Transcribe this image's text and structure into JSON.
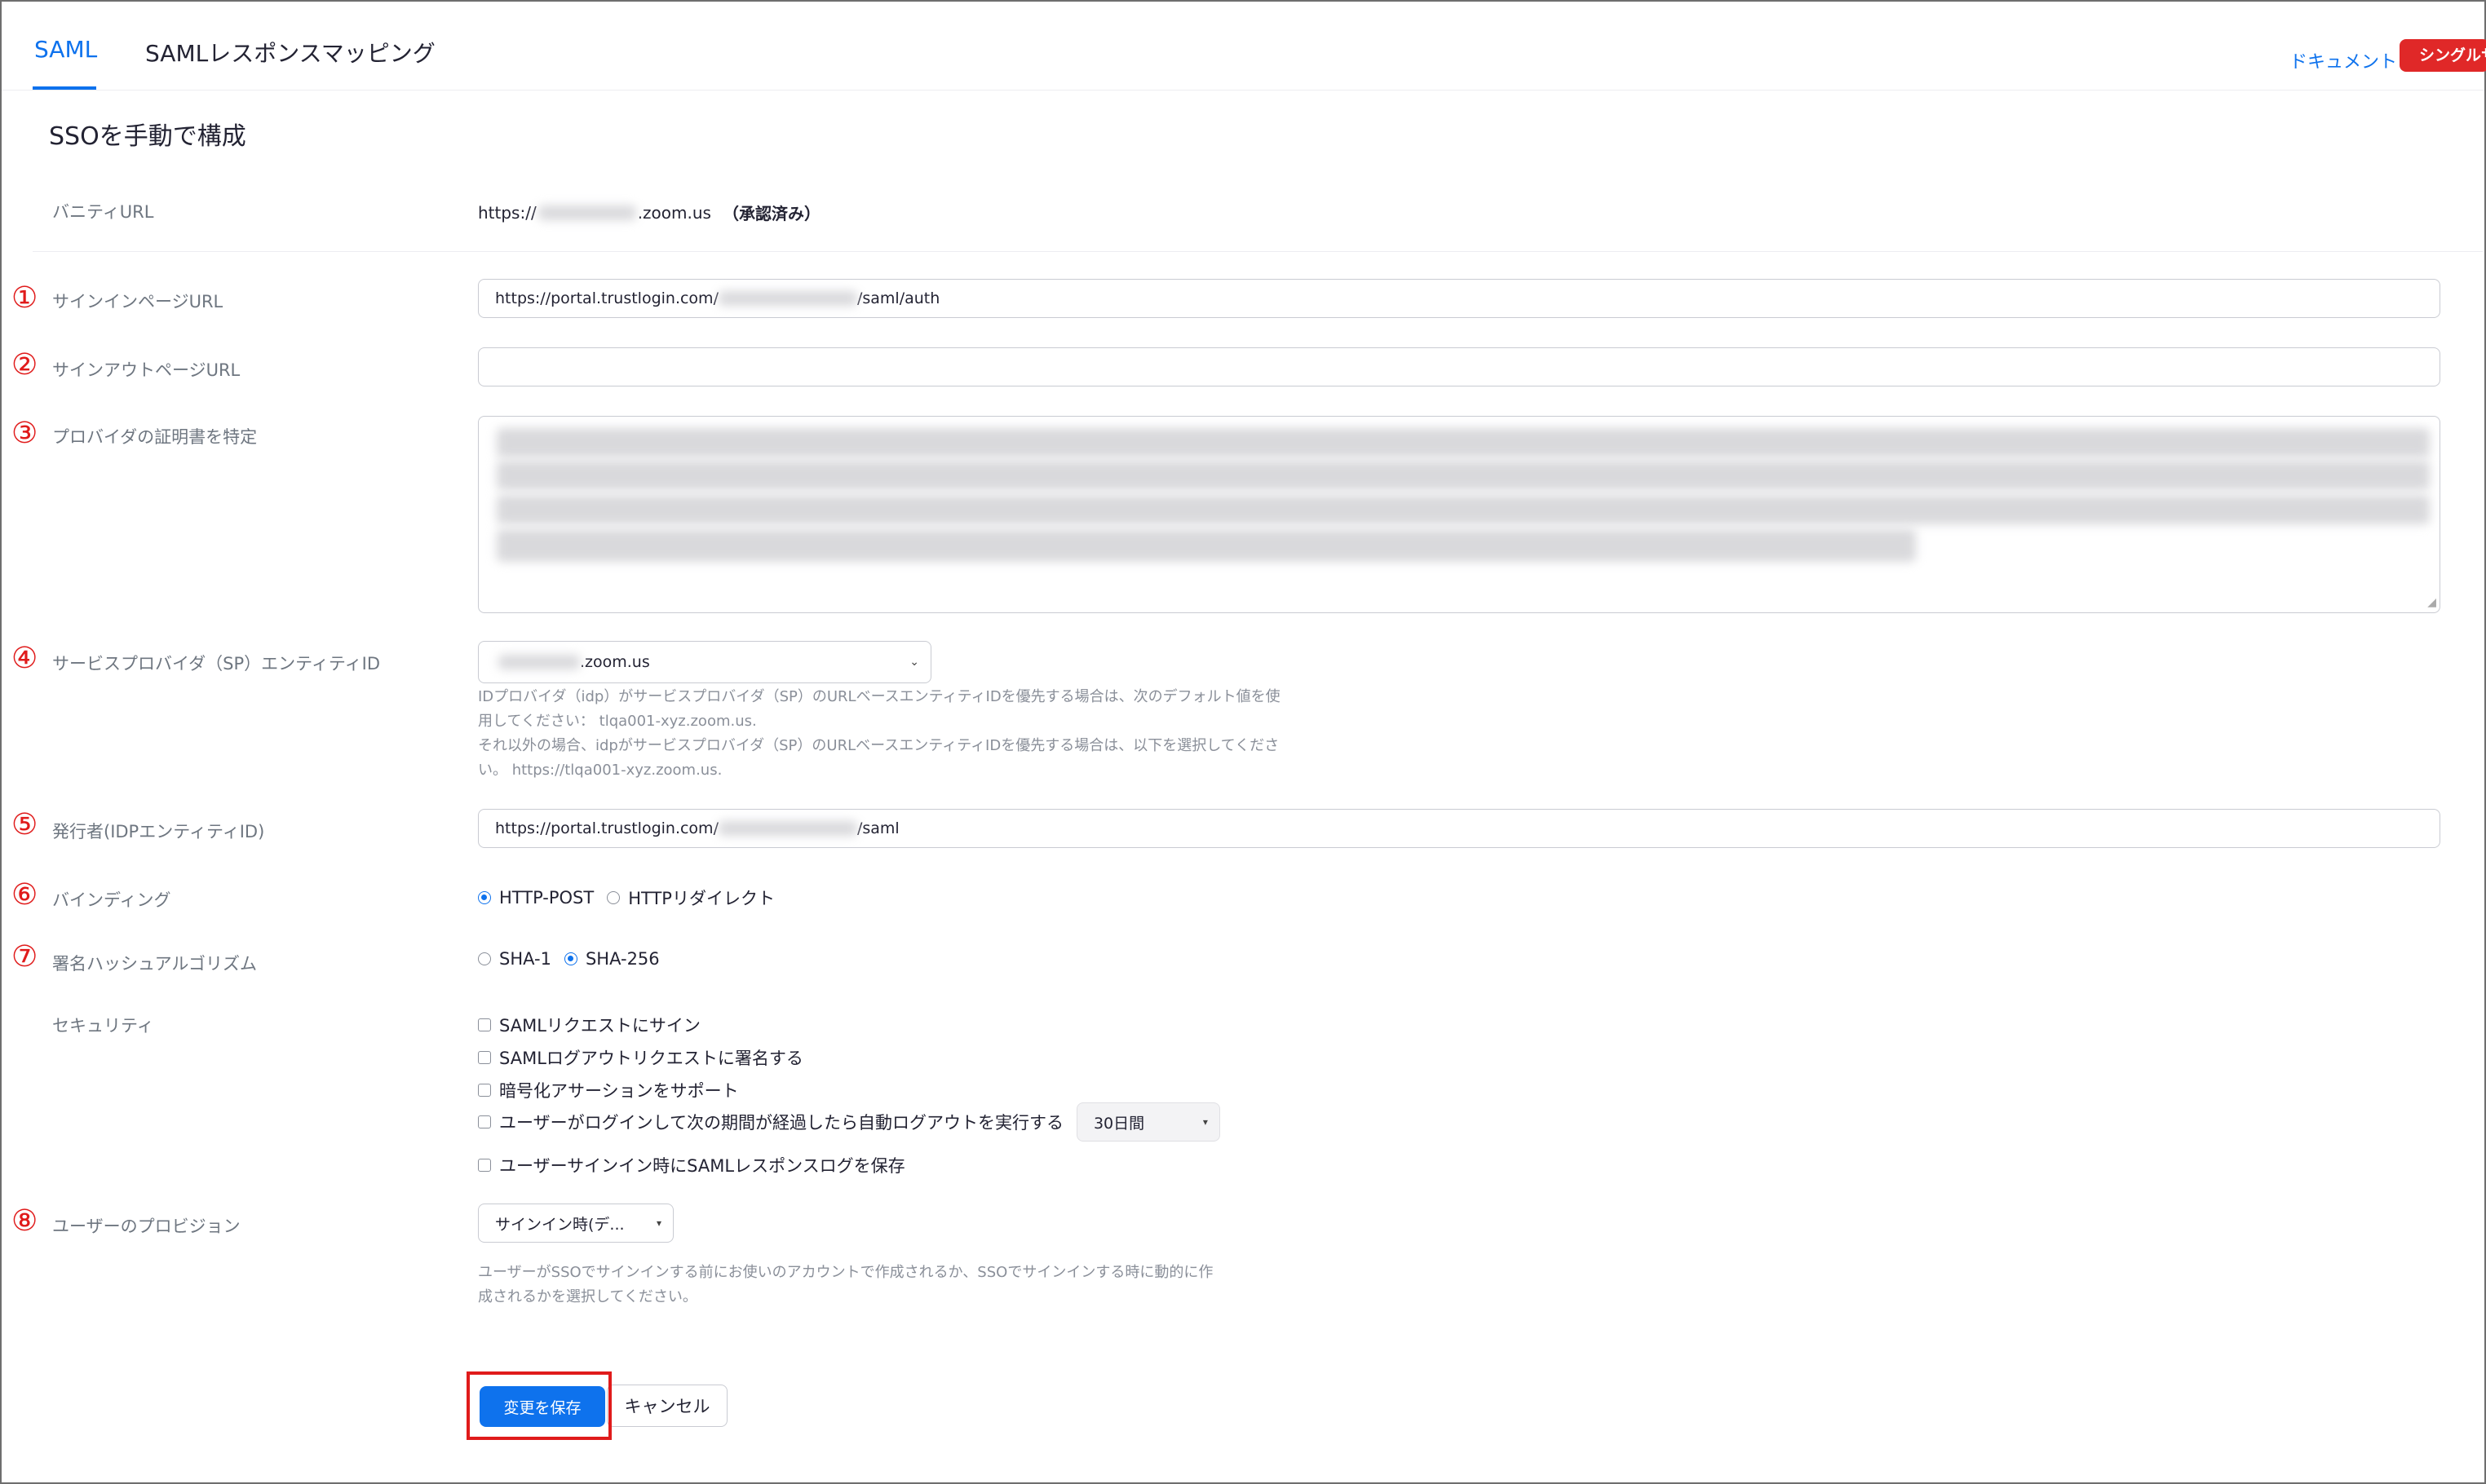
{
  "tabs": [
    {
      "label": "SAML",
      "active": true
    },
    {
      "label": "SAMLレスポンスマッピング",
      "active": false
    }
  ],
  "header_links": {
    "document": "ドキュメント",
    "single_btn": "シングルサ"
  },
  "section_title": "SSOを手動で構成",
  "vanity": {
    "label": "バニティURL",
    "value_prefix": "https://",
    "value_suffix": ".zoom.us",
    "status": "（承認済み）"
  },
  "numbers": [
    "①",
    "②",
    "③",
    "④",
    "⑤",
    "⑥",
    "⑦",
    "⑧"
  ],
  "fields": {
    "signin": {
      "label": "サインインページURL",
      "prefix": "https://portal.trustlogin.com/",
      "suffix": "/saml/auth"
    },
    "signout": {
      "label": "サインアウトページURL",
      "value": ""
    },
    "cert": {
      "label": "プロバイダの証明書を特定"
    },
    "sp_entity": {
      "label": "サービスプロバイダ（SP）エンティティID",
      "selected_suffix": ".zoom.us",
      "help": [
        "IDプロバイダ（idp）がサービスプロバイダ（SP）のURLベースエンティティIDを優先する場合は、次のデフォルト値を使",
        "用してください： tlqa001-xyz.zoom.us.",
        "それ以外の場合、idpがサービスプロバイダ（SP）のURLベースエンティティIDを優先する場合は、以下を選択してくださ",
        "い。 https://tlqa001-xyz.zoom.us."
      ]
    },
    "issuer": {
      "label": "発行者(IDPエンティティID)",
      "prefix": "https://portal.trustlogin.com/",
      "suffix": "/saml"
    },
    "binding": {
      "label": "バインディング",
      "options": [
        "HTTP-POST",
        "HTTPリダイレクト"
      ],
      "selected": 0
    },
    "hash": {
      "label": "署名ハッシュアルゴリズム",
      "options": [
        "SHA-1",
        "SHA-256"
      ],
      "selected": 1
    },
    "security": {
      "label": "セキュリティ",
      "options": [
        "SAMLリクエストにサイン",
        "SAMLログアウトリクエストに署名する",
        "暗号化アサーションをサポート",
        "ユーザーがログインして次の期間が経過したら自動ログアウトを実行する",
        "ユーザーサインイン時にSAMLレスポンスログを保存"
      ],
      "period_select": "30日間"
    },
    "provision": {
      "label": "ユーザーのプロビジョン",
      "selected": "サインイン時(デ...",
      "help": [
        "ユーザーがSSOでサインインする前にお使いのアカウントで作成されるか、SSOでサインインする時に動的に作",
        "成されるかを選択してください。"
      ]
    }
  },
  "buttons": {
    "save": "変更を保存",
    "cancel": "キャンセル"
  },
  "colors": {
    "accent": "#0e72ed",
    "annotation": "#e01b1b",
    "brand_red": "#e02828"
  }
}
